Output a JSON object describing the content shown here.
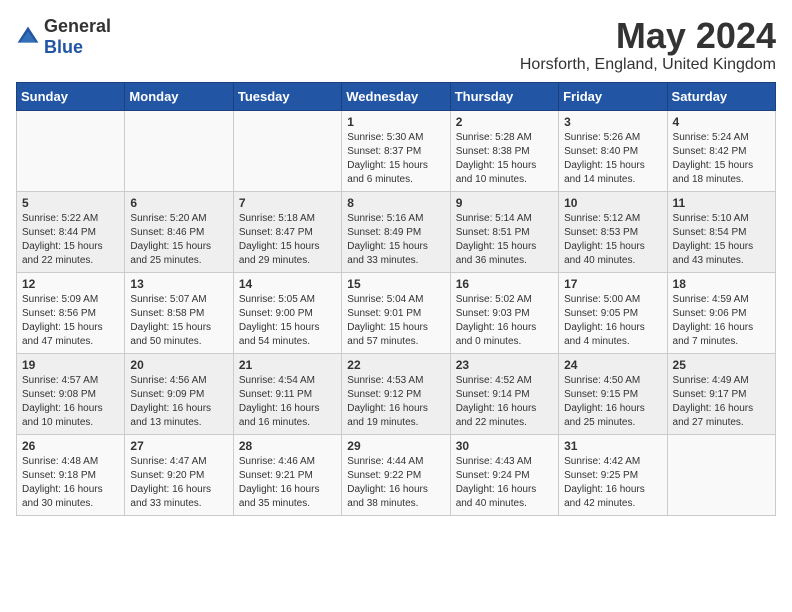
{
  "logo": {
    "general": "General",
    "blue": "Blue"
  },
  "header": {
    "month": "May 2024",
    "location": "Horsforth, England, United Kingdom"
  },
  "weekdays": [
    "Sunday",
    "Monday",
    "Tuesday",
    "Wednesday",
    "Thursday",
    "Friday",
    "Saturday"
  ],
  "weeks": [
    [
      {
        "day": "",
        "info": ""
      },
      {
        "day": "",
        "info": ""
      },
      {
        "day": "",
        "info": ""
      },
      {
        "day": "1",
        "info": "Sunrise: 5:30 AM\nSunset: 8:37 PM\nDaylight: 15 hours\nand 6 minutes."
      },
      {
        "day": "2",
        "info": "Sunrise: 5:28 AM\nSunset: 8:38 PM\nDaylight: 15 hours\nand 10 minutes."
      },
      {
        "day": "3",
        "info": "Sunrise: 5:26 AM\nSunset: 8:40 PM\nDaylight: 15 hours\nand 14 minutes."
      },
      {
        "day": "4",
        "info": "Sunrise: 5:24 AM\nSunset: 8:42 PM\nDaylight: 15 hours\nand 18 minutes."
      }
    ],
    [
      {
        "day": "5",
        "info": "Sunrise: 5:22 AM\nSunset: 8:44 PM\nDaylight: 15 hours\nand 22 minutes."
      },
      {
        "day": "6",
        "info": "Sunrise: 5:20 AM\nSunset: 8:46 PM\nDaylight: 15 hours\nand 25 minutes."
      },
      {
        "day": "7",
        "info": "Sunrise: 5:18 AM\nSunset: 8:47 PM\nDaylight: 15 hours\nand 29 minutes."
      },
      {
        "day": "8",
        "info": "Sunrise: 5:16 AM\nSunset: 8:49 PM\nDaylight: 15 hours\nand 33 minutes."
      },
      {
        "day": "9",
        "info": "Sunrise: 5:14 AM\nSunset: 8:51 PM\nDaylight: 15 hours\nand 36 minutes."
      },
      {
        "day": "10",
        "info": "Sunrise: 5:12 AM\nSunset: 8:53 PM\nDaylight: 15 hours\nand 40 minutes."
      },
      {
        "day": "11",
        "info": "Sunrise: 5:10 AM\nSunset: 8:54 PM\nDaylight: 15 hours\nand 43 minutes."
      }
    ],
    [
      {
        "day": "12",
        "info": "Sunrise: 5:09 AM\nSunset: 8:56 PM\nDaylight: 15 hours\nand 47 minutes."
      },
      {
        "day": "13",
        "info": "Sunrise: 5:07 AM\nSunset: 8:58 PM\nDaylight: 15 hours\nand 50 minutes."
      },
      {
        "day": "14",
        "info": "Sunrise: 5:05 AM\nSunset: 9:00 PM\nDaylight: 15 hours\nand 54 minutes."
      },
      {
        "day": "15",
        "info": "Sunrise: 5:04 AM\nSunset: 9:01 PM\nDaylight: 15 hours\nand 57 minutes."
      },
      {
        "day": "16",
        "info": "Sunrise: 5:02 AM\nSunset: 9:03 PM\nDaylight: 16 hours\nand 0 minutes."
      },
      {
        "day": "17",
        "info": "Sunrise: 5:00 AM\nSunset: 9:05 PM\nDaylight: 16 hours\nand 4 minutes."
      },
      {
        "day": "18",
        "info": "Sunrise: 4:59 AM\nSunset: 9:06 PM\nDaylight: 16 hours\nand 7 minutes."
      }
    ],
    [
      {
        "day": "19",
        "info": "Sunrise: 4:57 AM\nSunset: 9:08 PM\nDaylight: 16 hours\nand 10 minutes."
      },
      {
        "day": "20",
        "info": "Sunrise: 4:56 AM\nSunset: 9:09 PM\nDaylight: 16 hours\nand 13 minutes."
      },
      {
        "day": "21",
        "info": "Sunrise: 4:54 AM\nSunset: 9:11 PM\nDaylight: 16 hours\nand 16 minutes."
      },
      {
        "day": "22",
        "info": "Sunrise: 4:53 AM\nSunset: 9:12 PM\nDaylight: 16 hours\nand 19 minutes."
      },
      {
        "day": "23",
        "info": "Sunrise: 4:52 AM\nSunset: 9:14 PM\nDaylight: 16 hours\nand 22 minutes."
      },
      {
        "day": "24",
        "info": "Sunrise: 4:50 AM\nSunset: 9:15 PM\nDaylight: 16 hours\nand 25 minutes."
      },
      {
        "day": "25",
        "info": "Sunrise: 4:49 AM\nSunset: 9:17 PM\nDaylight: 16 hours\nand 27 minutes."
      }
    ],
    [
      {
        "day": "26",
        "info": "Sunrise: 4:48 AM\nSunset: 9:18 PM\nDaylight: 16 hours\nand 30 minutes."
      },
      {
        "day": "27",
        "info": "Sunrise: 4:47 AM\nSunset: 9:20 PM\nDaylight: 16 hours\nand 33 minutes."
      },
      {
        "day": "28",
        "info": "Sunrise: 4:46 AM\nSunset: 9:21 PM\nDaylight: 16 hours\nand 35 minutes."
      },
      {
        "day": "29",
        "info": "Sunrise: 4:44 AM\nSunset: 9:22 PM\nDaylight: 16 hours\nand 38 minutes."
      },
      {
        "day": "30",
        "info": "Sunrise: 4:43 AM\nSunset: 9:24 PM\nDaylight: 16 hours\nand 40 minutes."
      },
      {
        "day": "31",
        "info": "Sunrise: 4:42 AM\nSunset: 9:25 PM\nDaylight: 16 hours\nand 42 minutes."
      },
      {
        "day": "",
        "info": ""
      }
    ]
  ]
}
